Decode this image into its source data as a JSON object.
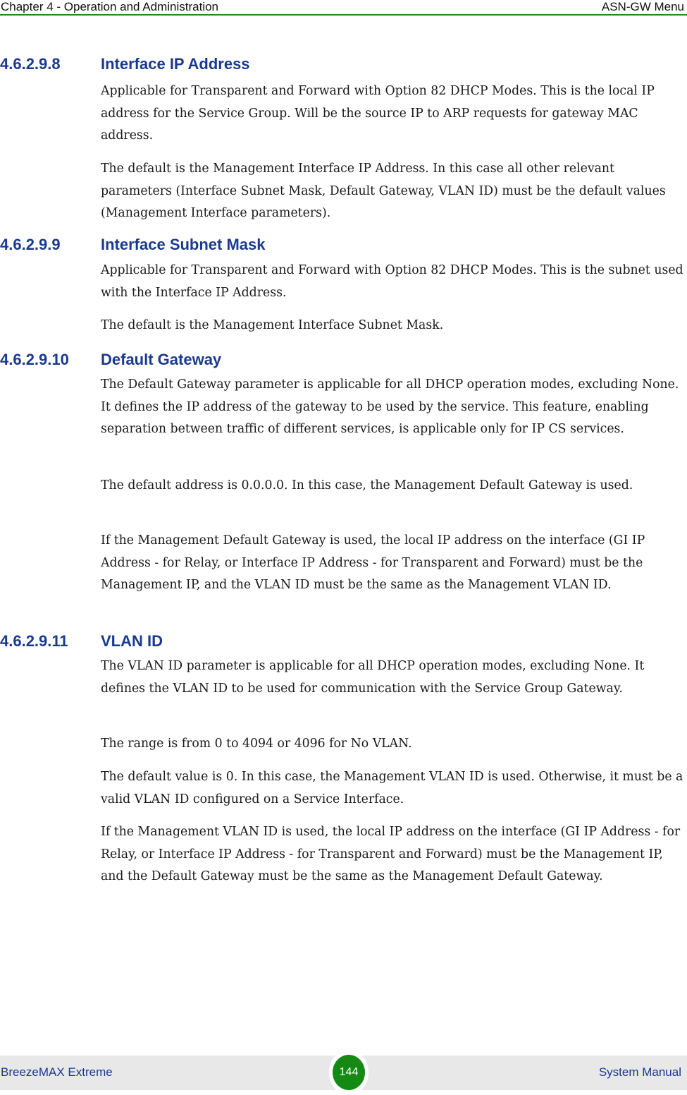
{
  "header": {
    "chapter": "Chapter 4 - Operation and Administration",
    "section": "ASN-GW Menu"
  },
  "sections": [
    {
      "number": "4.6.2.9.8",
      "title": "Interface IP Address",
      "paragraphs": [
        "Applicable for Transparent and Forward with Option 82 DHCP Modes. This is the local IP address for the Service Group. Will be the source IP to ARP requests for gateway MAC address.",
        "The default is the Management Interface IP Address. In this case all other relevant parameters (Interface Subnet Mask, Default Gateway, VLAN ID) must be the default values (Management Interface parameters)."
      ]
    },
    {
      "number": "4.6.2.9.9",
      "title": "Interface Subnet Mask",
      "paragraphs": [
        "Applicable for Transparent and Forward with Option 82 DHCP Modes. This is the subnet used with the Interface IP Address.",
        "The default is the Management Interface Subnet Mask."
      ]
    },
    {
      "number": "4.6.2.9.10",
      "title": "Default Gateway",
      "paragraphs": [
        "The Default Gateway parameter is applicable for all DHCP operation modes, excluding None. It defines the IP address of the gateway to be used by the service. This feature, enabling separation between traffic of different services, is applicable only for IP CS services.",
        "The default address is 0.0.0.0. In this case, the Management Default Gateway is used.",
        "If the Management Default Gateway is used, the local IP address on the interface (GI IP Address - for Relay, or Interface IP Address - for Transparent and Forward) must be the Management IP, and the VLAN ID must be the same as the Management VLAN ID."
      ]
    },
    {
      "number": "4.6.2.9.11",
      "title": "VLAN ID",
      "paragraphs": [
        "The VLAN ID parameter is applicable for all DHCP operation modes, excluding None. It defines the VLAN ID to be used for communication with the Service Group Gateway.",
        "The range is from 0 to 4094 or 4096 for No VLAN.",
        "The default value is 0. In this case, the Management VLAN ID is used. Otherwise, it must be a valid VLAN ID configured on a Service Interface.",
        "If the Management VLAN ID is used, the local IP address on the interface (GI IP Address - for Relay, or Interface IP Address - for Transparent and Forward) must be the Management IP, and the Default Gateway must be the same as the Management Default Gateway."
      ]
    }
  ],
  "footer": {
    "product": "BreezeMAX Extreme",
    "page_number": "144",
    "document": "System Manual"
  }
}
